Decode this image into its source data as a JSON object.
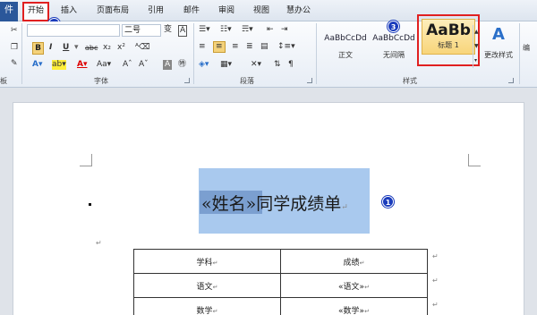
{
  "tabs": {
    "file": "件",
    "items": [
      "开始",
      "插入",
      "页面布局",
      "引用",
      "邮件",
      "审阅",
      "视图",
      "慧办公"
    ]
  },
  "ribbon": {
    "font_size": "二号",
    "font_group_label": "字体",
    "paragraph_group_label": "段落",
    "styles_group_label": "样式",
    "clipboard_group_label": "板",
    "styles": [
      {
        "sample": "AaBbCcDd",
        "name": "正文"
      },
      {
        "sample": "AaBbCcDd",
        "name": "无间隔"
      },
      {
        "sample": "AaBb",
        "name": "标题 1"
      }
    ],
    "change_styles_label": "更改样式",
    "edit_label": "编"
  },
  "badges": [
    "1",
    "2",
    "3"
  ],
  "document": {
    "title_field": "«姓名»",
    "title_rest": "同学成绩单",
    "table": {
      "rows": [
        [
          "学科",
          "成绩"
        ],
        [
          "语文",
          "«语文»"
        ],
        [
          "数学",
          "«数学»"
        ]
      ]
    }
  },
  "colors": {
    "accent_red": "#e02020",
    "badge_blue": "#1a3cbc",
    "file_tab": "#2b579a",
    "selection": "#a9c9ee"
  }
}
